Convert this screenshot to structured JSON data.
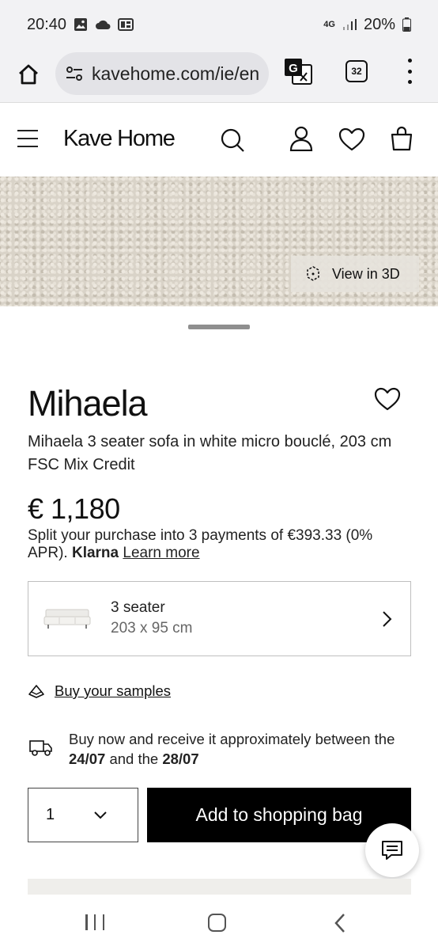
{
  "status_bar": {
    "time": "20:40",
    "network": "4G",
    "battery": "20%"
  },
  "browser": {
    "url": "kavehome.com/ie/en",
    "tab_count": "32"
  },
  "site_header": {
    "logo": "Kave Home"
  },
  "product_image": {
    "view_3d_label": "View in 3D"
  },
  "product": {
    "title": "Mihaela",
    "subtitle": "Mihaela 3 seater sofa in white micro bouclé, 203 cm FSC Mix Credit",
    "price": "€ 1,180",
    "financing": {
      "text": "Split your purchase into 3 payments of €393.33 (0% APR).",
      "brand": "Klarna",
      "link": "Learn more"
    },
    "variant": {
      "name": "3 seater",
      "dimensions": "203 x 95 cm"
    },
    "samples_link": "Buy your samples",
    "delivery": {
      "prefix": "Buy now and receive it approximately between the",
      "date_from": "24/07",
      "middle": "and the",
      "date_to": "28/07"
    },
    "quantity": "1",
    "add_to_bag_label": "Add to shopping bag"
  },
  "icons": [
    "home-icon",
    "tune-icon",
    "translate-icon",
    "tabs-icon",
    "more-icon",
    "menu-icon",
    "search-icon",
    "user-icon",
    "heart-icon",
    "bag-icon",
    "3d-icon",
    "chevron-right-icon",
    "chevron-down-icon",
    "samples-icon",
    "truck-icon",
    "chat-icon"
  ],
  "colors": {
    "primary_button": "#000000",
    "accent_text": "#111111",
    "border": "#bfbfbf"
  }
}
